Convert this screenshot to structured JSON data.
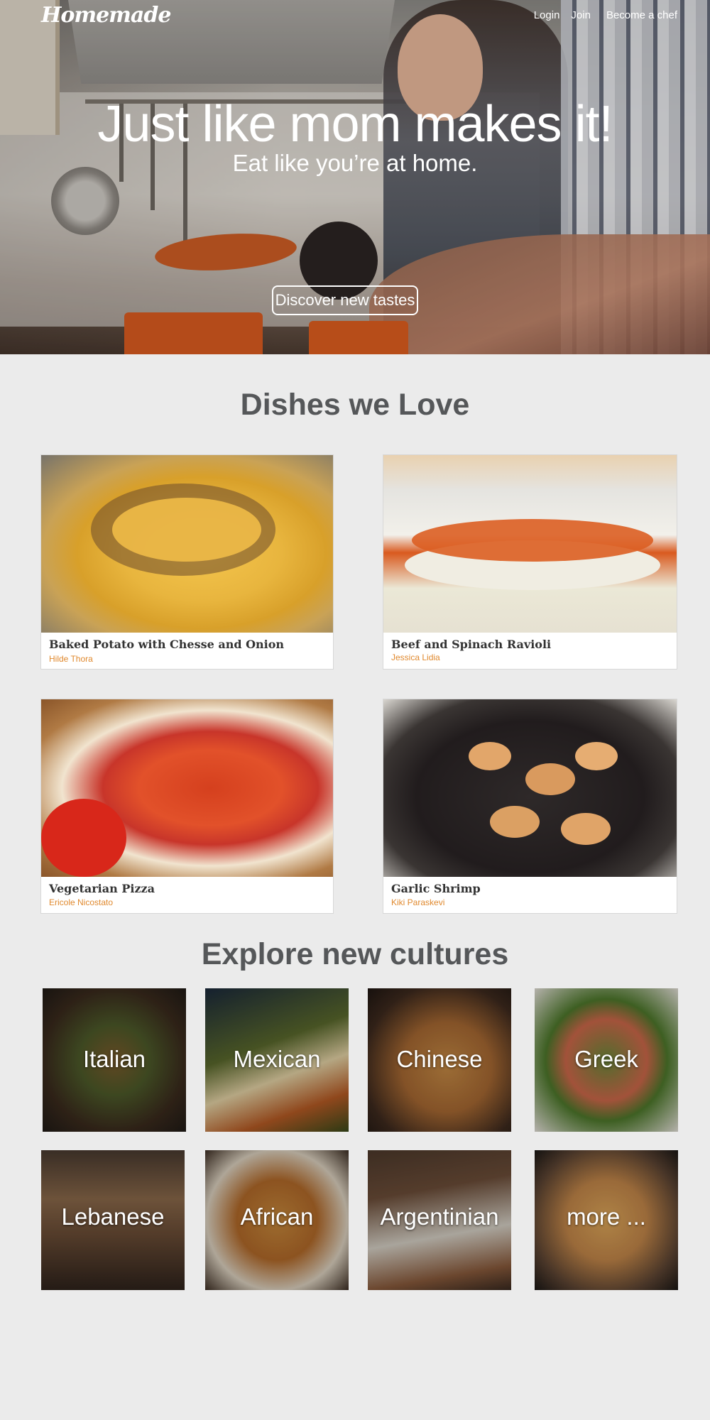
{
  "nav": {
    "logo": "Homemade",
    "links": [
      "Login",
      "Join",
      "Become a chef"
    ]
  },
  "hero": {
    "title": "Just like mom makes it!",
    "subtitle": "Eat like you’re at home.",
    "cta": "Discover new tastes"
  },
  "dishes": {
    "title": "Dishes we Love",
    "items": [
      {
        "name": "Baked Potato with Chesse and Onion",
        "chef": "Hilde Thora",
        "image": "baked-potato-image"
      },
      {
        "name": "Beef and Spinach Ravioli",
        "chef": "Jessica Lidia",
        "image": "ravioli-image"
      },
      {
        "name": "Vegetarian Pizza",
        "chef": "Ericole Nicostato",
        "image": "pizza-image"
      },
      {
        "name": "Garlic Shrimp",
        "chef": "Kiki Paraskevi",
        "image": "shrimp-image"
      }
    ]
  },
  "cultures": {
    "title": "Explore new cultures",
    "items": [
      "Italian",
      "Mexican",
      "Chinese",
      "Greek",
      "Lebanese",
      "African",
      "Argentinian",
      "more ..."
    ]
  },
  "colors": {
    "background": "#ebebeb",
    "heading": "#555759",
    "chef_accent": "#e0892e"
  }
}
